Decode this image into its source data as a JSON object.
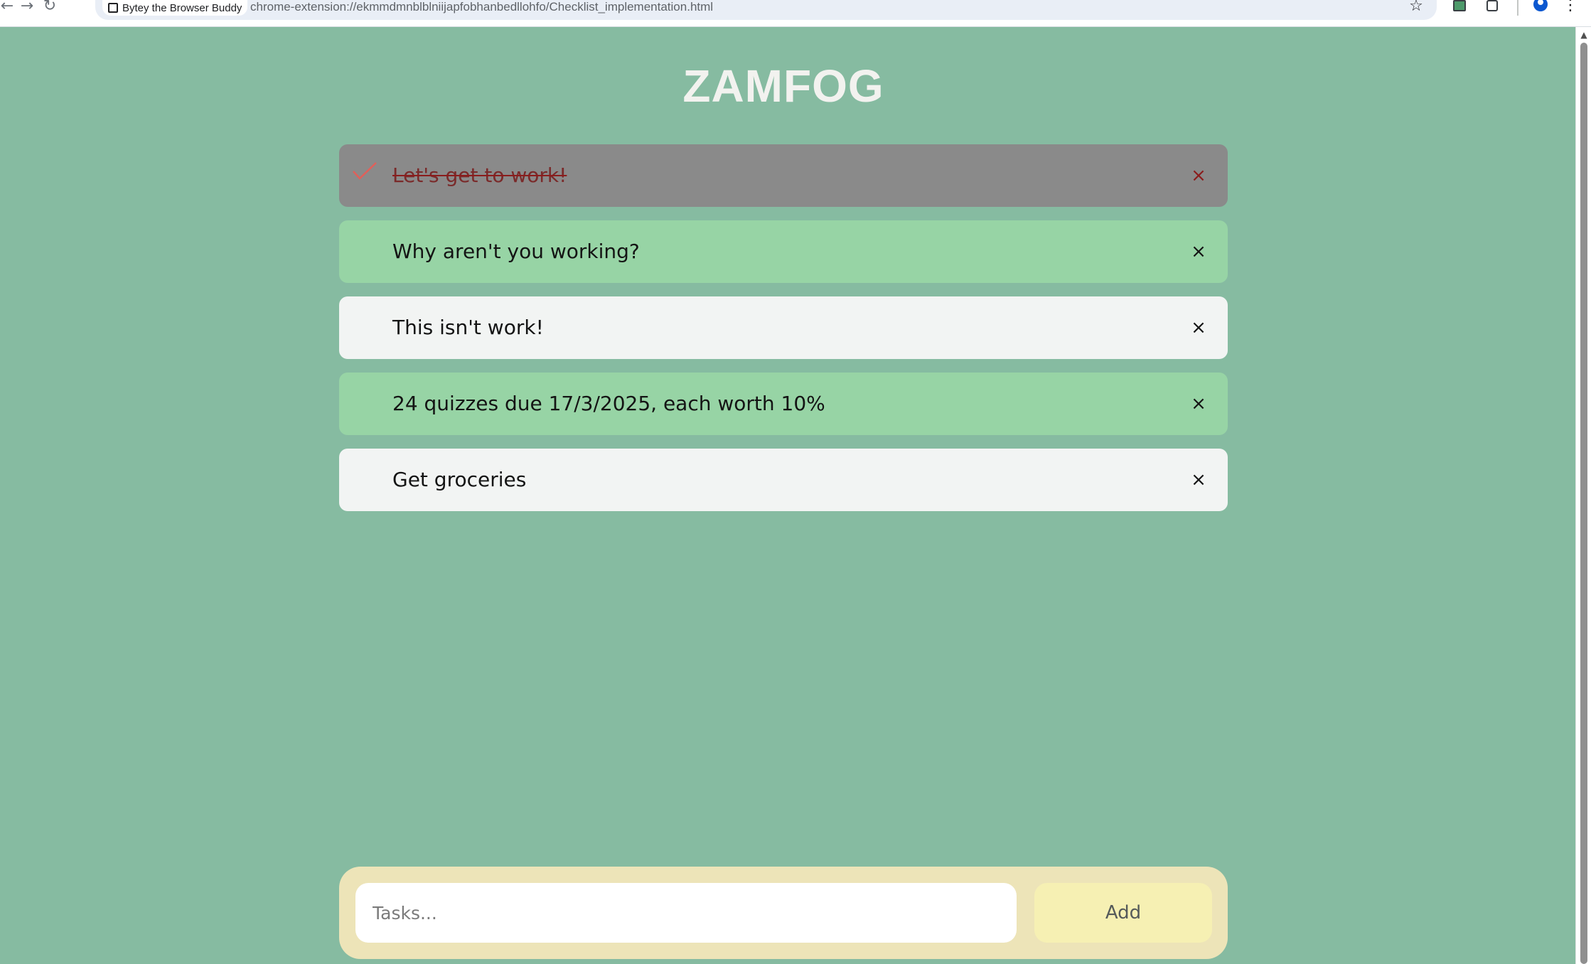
{
  "browser": {
    "site_name": "Bytey the Browser Buddy",
    "url": "chrome-extension://ekmmdmnblblniijapfobhanbedllohfo/Checklist_implementation.html",
    "back_icon": "arrow-left-icon",
    "forward_icon": "arrow-right-icon",
    "reload_icon": "reload-icon",
    "star_icon": "star-icon",
    "menu_icon": "kebab-menu-icon"
  },
  "app": {
    "title": "ZAMFOG"
  },
  "tasks": [
    {
      "text": "Let's get to work!",
      "done": true,
      "color": "#8a8a8a"
    },
    {
      "text": "Why aren't you working?",
      "done": false,
      "color": "#97d4a5"
    },
    {
      "text": "This isn't work!",
      "done": false,
      "color": "#f2f4f3"
    },
    {
      "text": "24 quizzes due 17/3/2025, each worth 10%",
      "done": false,
      "color": "#97d4a5"
    },
    {
      "text": "Get groceries",
      "done": false,
      "color": "#f2f4f3"
    }
  ],
  "close_glyph": "×",
  "input": {
    "placeholder": "Tasks...",
    "value": "",
    "add_label": "Add"
  },
  "colors": {
    "background": "#86bba1",
    "done_strike": "#8b1c1c",
    "check": "#e0605a",
    "input_bar": "#ede4b8",
    "add_button": "#f6f0b3"
  }
}
